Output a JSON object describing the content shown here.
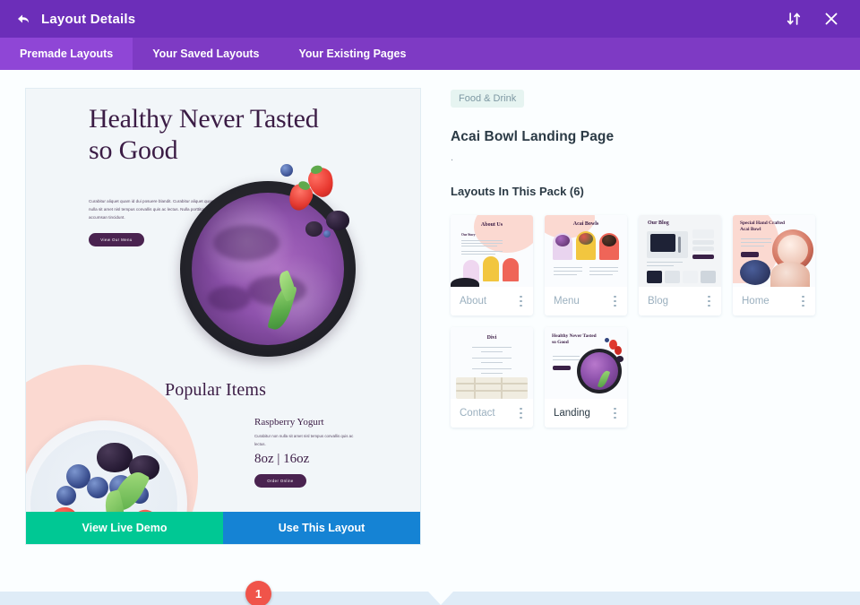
{
  "header": {
    "title": "Layout Details",
    "back_icon": "back-arrow-icon",
    "sort_icon": "sort-arrows-icon",
    "close_icon": "close-icon"
  },
  "tabs": [
    {
      "label": "Premade Layouts",
      "active": true
    },
    {
      "label": "Your Saved Layouts",
      "active": false
    },
    {
      "label": "Your Existing Pages",
      "active": false
    }
  ],
  "preview": {
    "headline": "Healthy Never Tasted so Good",
    "paragraph": "Curabitur aliquet quam id dui posuere blandit. Curabitur aliquet quam non nulla sit amet nisl tempus convallis quis ac lectus. Nulla porttitor accumsan tincidunt.",
    "cta": "View Our Menu",
    "section_title": "Popular Items",
    "item_title": "Raspberry Yogurt",
    "item_paragraph": "Curabitur non nulla sit amet nisl tempus convallis quis ac lectus.",
    "item_sizes": "8oz | 16oz",
    "item_cta": "Order Online",
    "demo_button": "View Live Demo",
    "use_button": "Use This Layout",
    "marker_number": "1"
  },
  "details": {
    "category_badge": "Food & Drink",
    "pack_title": "Acai Bowl Landing Page",
    "pack_description": ".",
    "pack_layouts_heading": "Layouts In This Pack (6)"
  },
  "layout_cards": [
    {
      "label": "About",
      "thumb_title": "About Us",
      "active": false
    },
    {
      "label": "Menu",
      "thumb_title": "Acai Bowls",
      "active": false
    },
    {
      "label": "Blog",
      "thumb_title": "Our Blog",
      "active": false
    },
    {
      "label": "Home",
      "thumb_title": "Special Hand Crafted Acai Bowl",
      "active": false
    },
    {
      "label": "Contact",
      "thumb_title": "Divi",
      "active": false
    },
    {
      "label": "Landing",
      "thumb_title": "Healthy Never Tasted so Good",
      "active": true
    }
  ],
  "colors": {
    "titlebar": "#6c2eb9",
    "tabbar": "#7e3ac4",
    "tab_active": "#8f46d6",
    "demo_button": "#00c894",
    "use_button": "#1583d4",
    "marker": "#f0544a",
    "badge_bg": "#e6f4f1",
    "badge_text": "#7e98a3",
    "footer_strip": "#dfecf7"
  }
}
